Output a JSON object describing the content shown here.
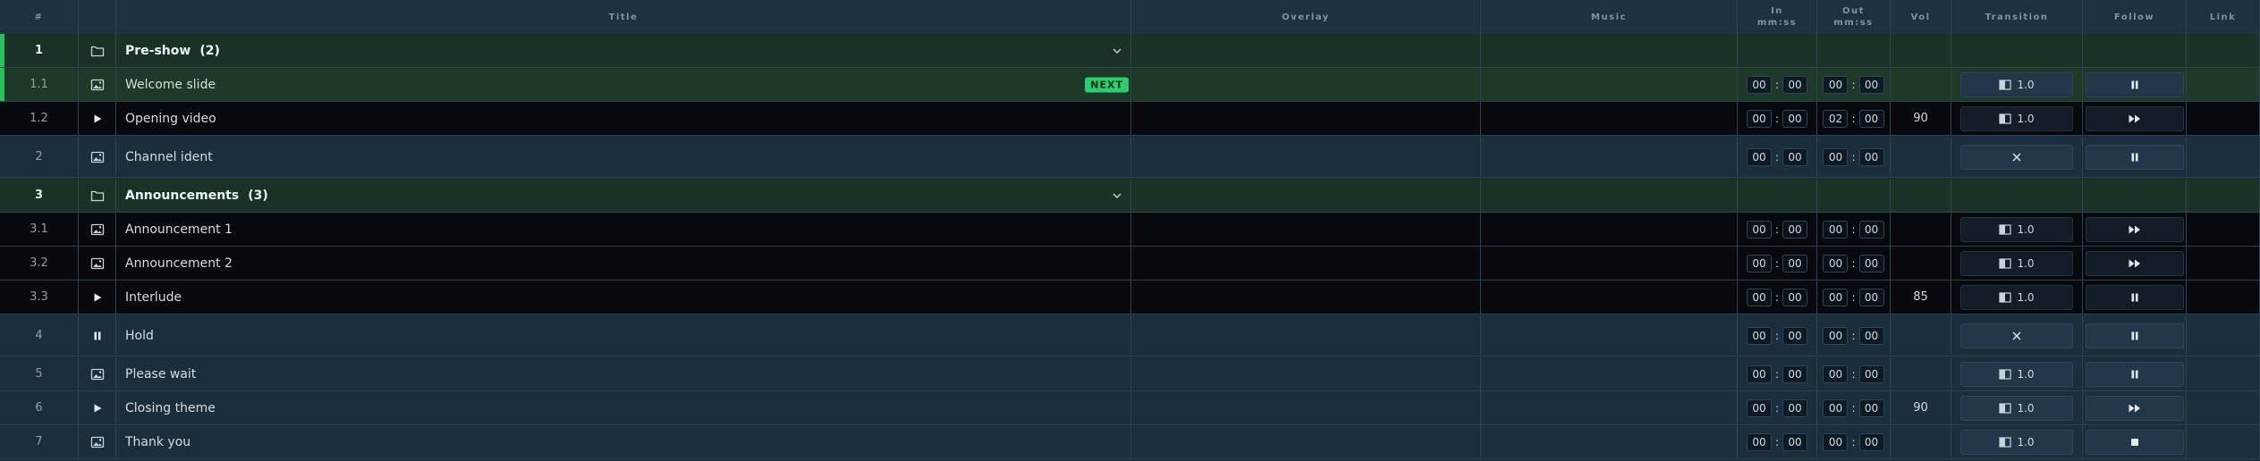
{
  "headers": {
    "num": "#",
    "title": "Title",
    "overlay": "Overlay",
    "music": "Music",
    "in_line1": "In",
    "in_line2": "mm:ss",
    "out_line1": "Out",
    "out_line2": "mm:ss",
    "vol": "Vol",
    "transition": "Transition",
    "follow": "Follow",
    "link": "Link"
  },
  "next_badge": "NEXT",
  "rows": [
    {
      "num": "1",
      "title": "Pre-show",
      "count": "(2)",
      "kind": "folder-icon",
      "group": true
    },
    {
      "num": "1.1",
      "title": "Welcome slide",
      "kind": "image-icon",
      "in": [
        "00",
        "00"
      ],
      "out": [
        "00",
        "00"
      ],
      "vol": "",
      "transition": "1.0",
      "transition_icon": "transition-icon",
      "follow": "pause-icon"
    },
    {
      "num": "1.2",
      "title": "Opening video",
      "kind": "play-icon",
      "in": [
        "00",
        "00"
      ],
      "out": [
        "02",
        "00"
      ],
      "vol": "90",
      "transition": "1.0",
      "transition_icon": "transition-icon",
      "follow": "fast-forward-icon"
    },
    {
      "num": "2",
      "title": "Channel ident",
      "kind": "image-icon",
      "in": [
        "00",
        "00"
      ],
      "out": [
        "00",
        "00"
      ],
      "vol": "",
      "transition": "",
      "transition_icon": "close-icon",
      "follow": "pause-icon"
    },
    {
      "num": "3",
      "title": "Announcements",
      "count": "(3)",
      "kind": "folder-icon",
      "group": true
    },
    {
      "num": "3.1",
      "title": "Announcement 1",
      "kind": "image-icon",
      "in": [
        "00",
        "00"
      ],
      "out": [
        "00",
        "00"
      ],
      "vol": "",
      "transition": "1.0",
      "transition_icon": "transition-icon",
      "follow": "fast-forward-icon"
    },
    {
      "num": "3.2",
      "title": "Announcement 2",
      "kind": "image-icon",
      "in": [
        "00",
        "00"
      ],
      "out": [
        "00",
        "00"
      ],
      "vol": "",
      "transition": "1.0",
      "transition_icon": "transition-icon",
      "follow": "fast-forward-icon"
    },
    {
      "num": "3.3",
      "title": "Interlude",
      "kind": "play-icon",
      "in": [
        "00",
        "00"
      ],
      "out": [
        "00",
        "00"
      ],
      "vol": "85",
      "transition": "1.0",
      "transition_icon": "transition-icon",
      "follow": "pause-icon"
    },
    {
      "num": "4",
      "title": "Hold",
      "kind": "pause-icon",
      "in": [
        "00",
        "00"
      ],
      "out": [
        "00",
        "00"
      ],
      "vol": "",
      "transition": "",
      "transition_icon": "close-icon",
      "follow": "pause-icon"
    },
    {
      "num": "5",
      "title": "Please wait",
      "kind": "image-icon",
      "in": [
        "00",
        "00"
      ],
      "out": [
        "00",
        "00"
      ],
      "vol": "",
      "transition": "1.0",
      "transition_icon": "transition-icon",
      "follow": "pause-icon"
    },
    {
      "num": "6",
      "title": "Closing theme",
      "kind": "play-icon",
      "in": [
        "00",
        "00"
      ],
      "out": [
        "00",
        "00"
      ],
      "vol": "90",
      "transition": "1.0",
      "transition_icon": "transition-icon",
      "follow": "fast-forward-icon"
    },
    {
      "num": "7",
      "title": "Thank you",
      "kind": "image-icon",
      "in": [
        "00",
        "00"
      ],
      "out": [
        "00",
        "00"
      ],
      "vol": "",
      "transition": "1.0",
      "transition_icon": "transition-icon",
      "follow": "stop-icon"
    }
  ]
}
